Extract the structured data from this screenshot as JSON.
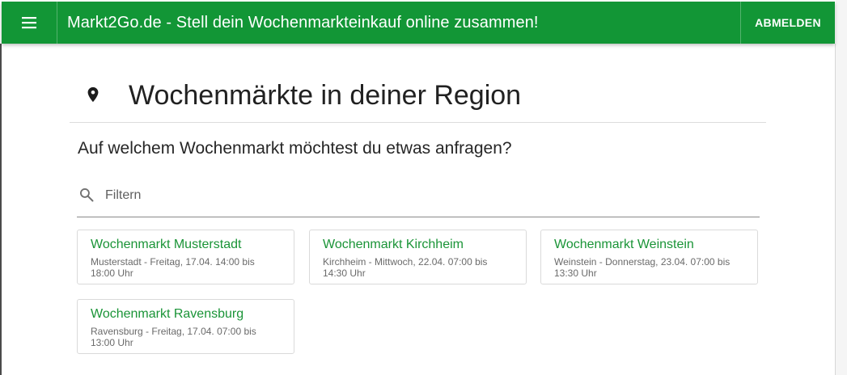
{
  "app_bar": {
    "menu_icon": "menu-icon",
    "title": "Markt2Go.de - Stell dein Wochenmarkteinkauf online zusammen!",
    "logout_label": "ABMELDEN",
    "color": "#129636"
  },
  "page": {
    "heading_icon": "location-pin-icon",
    "heading": "Wochenmärkte in deiner Region",
    "question": "Auf welchem Wochenmarkt möchtest du etwas anfragen?"
  },
  "filter": {
    "icon": "search-icon",
    "placeholder": "Filtern",
    "value": ""
  },
  "markets": [
    {
      "name": "Wochenmarkt Musterstadt",
      "details": "Musterstadt - Freitag, 17.04. 14:00 bis 18:00 Uhr"
    },
    {
      "name": "Wochenmarkt Kirchheim",
      "details": "Kirchheim - Mittwoch, 22.04. 07:00 bis 14:30 Uhr"
    },
    {
      "name": "Wochenmarkt Weinstein",
      "details": "Weinstein - Donnerstag, 23.04. 07:00 bis 13:30 Uhr"
    },
    {
      "name": "Wochenmarkt Ravensburg",
      "details": "Ravensburg - Freitag, 17.04. 07:00 bis 13:00 Uhr"
    }
  ],
  "colors": {
    "accent": "#129636",
    "card_title": "#1a9437"
  }
}
